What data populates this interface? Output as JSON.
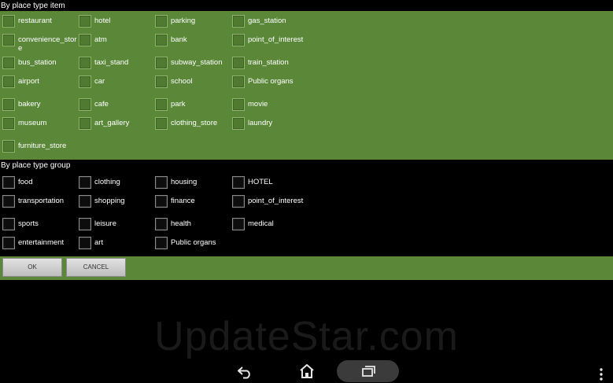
{
  "place_type_item": {
    "title": "By place type item",
    "rows": [
      [
        "restaurant",
        "hotel",
        "parking",
        "gas_station"
      ],
      [
        "convenience_store",
        "atm",
        "bank",
        "point_of_interest"
      ],
      [
        "bus_station",
        "taxi_stand",
        "subway_station",
        "train_station"
      ],
      [
        "airport",
        "car",
        "school",
        "Public organs"
      ],
      [
        "bakery",
        "cafe",
        "park",
        "movie"
      ],
      [
        "museum",
        "art_gallery",
        "clothing_store",
        "laundry"
      ],
      [
        "furniture_store"
      ]
    ]
  },
  "place_type_group": {
    "title": "By place type group",
    "rows": [
      [
        "food",
        "clothing",
        "housing",
        "HOTEL"
      ],
      [
        "transportation",
        "shopping",
        "finance",
        "point_of_interest"
      ],
      [
        "sports",
        "leisure",
        "health",
        "medical"
      ],
      [
        "entertainment",
        "art",
        "Public organs"
      ]
    ]
  },
  "buttons": {
    "ok": "OK",
    "cancel": "CANCEL"
  },
  "watermark": "UpdateStar.com",
  "nav_icons": [
    "back-icon",
    "home-icon",
    "recent-apps-icon",
    "overflow-menu-icon"
  ],
  "colors": {
    "panel_green": "#5a8838",
    "background": "#000000"
  }
}
